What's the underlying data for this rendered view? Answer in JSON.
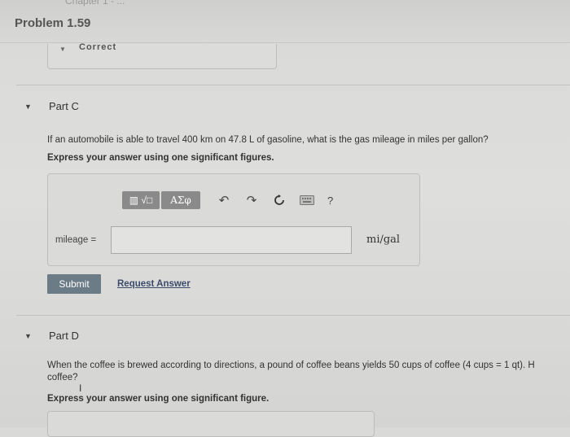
{
  "header": {
    "ghost_text": "Chapter 1 - ...",
    "problem_title": "Problem 1.59"
  },
  "collapsed_part": {
    "status": "Correct"
  },
  "part_c": {
    "label": "Part C",
    "question": "If an automobile is able to travel 400 km on 47.8 L of gasoline, what is the gas mileage in miles per gallon?",
    "instruction": "Express your answer using one significant figures.",
    "toolbar": {
      "templates_label": "▥ √□",
      "greek_label": "ΑΣφ",
      "undo": "undo-icon",
      "redo": "redo-icon",
      "reset": "reset-icon",
      "keyboard": "keyboard-icon",
      "help_label": "?"
    },
    "answer_label": "mileage =",
    "answer_value": "",
    "unit": "mi/gal",
    "submit_label": "Submit",
    "request_answer_label": "Request Answer"
  },
  "part_d": {
    "label": "Part D",
    "question_line1": "When the coffee is brewed according to directions, a pound of coffee beans yields 50 cups of coffee (4 cups = 1 qt). H",
    "question_line2": "coffee?",
    "instruction": "Express your answer using one significant figure."
  }
}
